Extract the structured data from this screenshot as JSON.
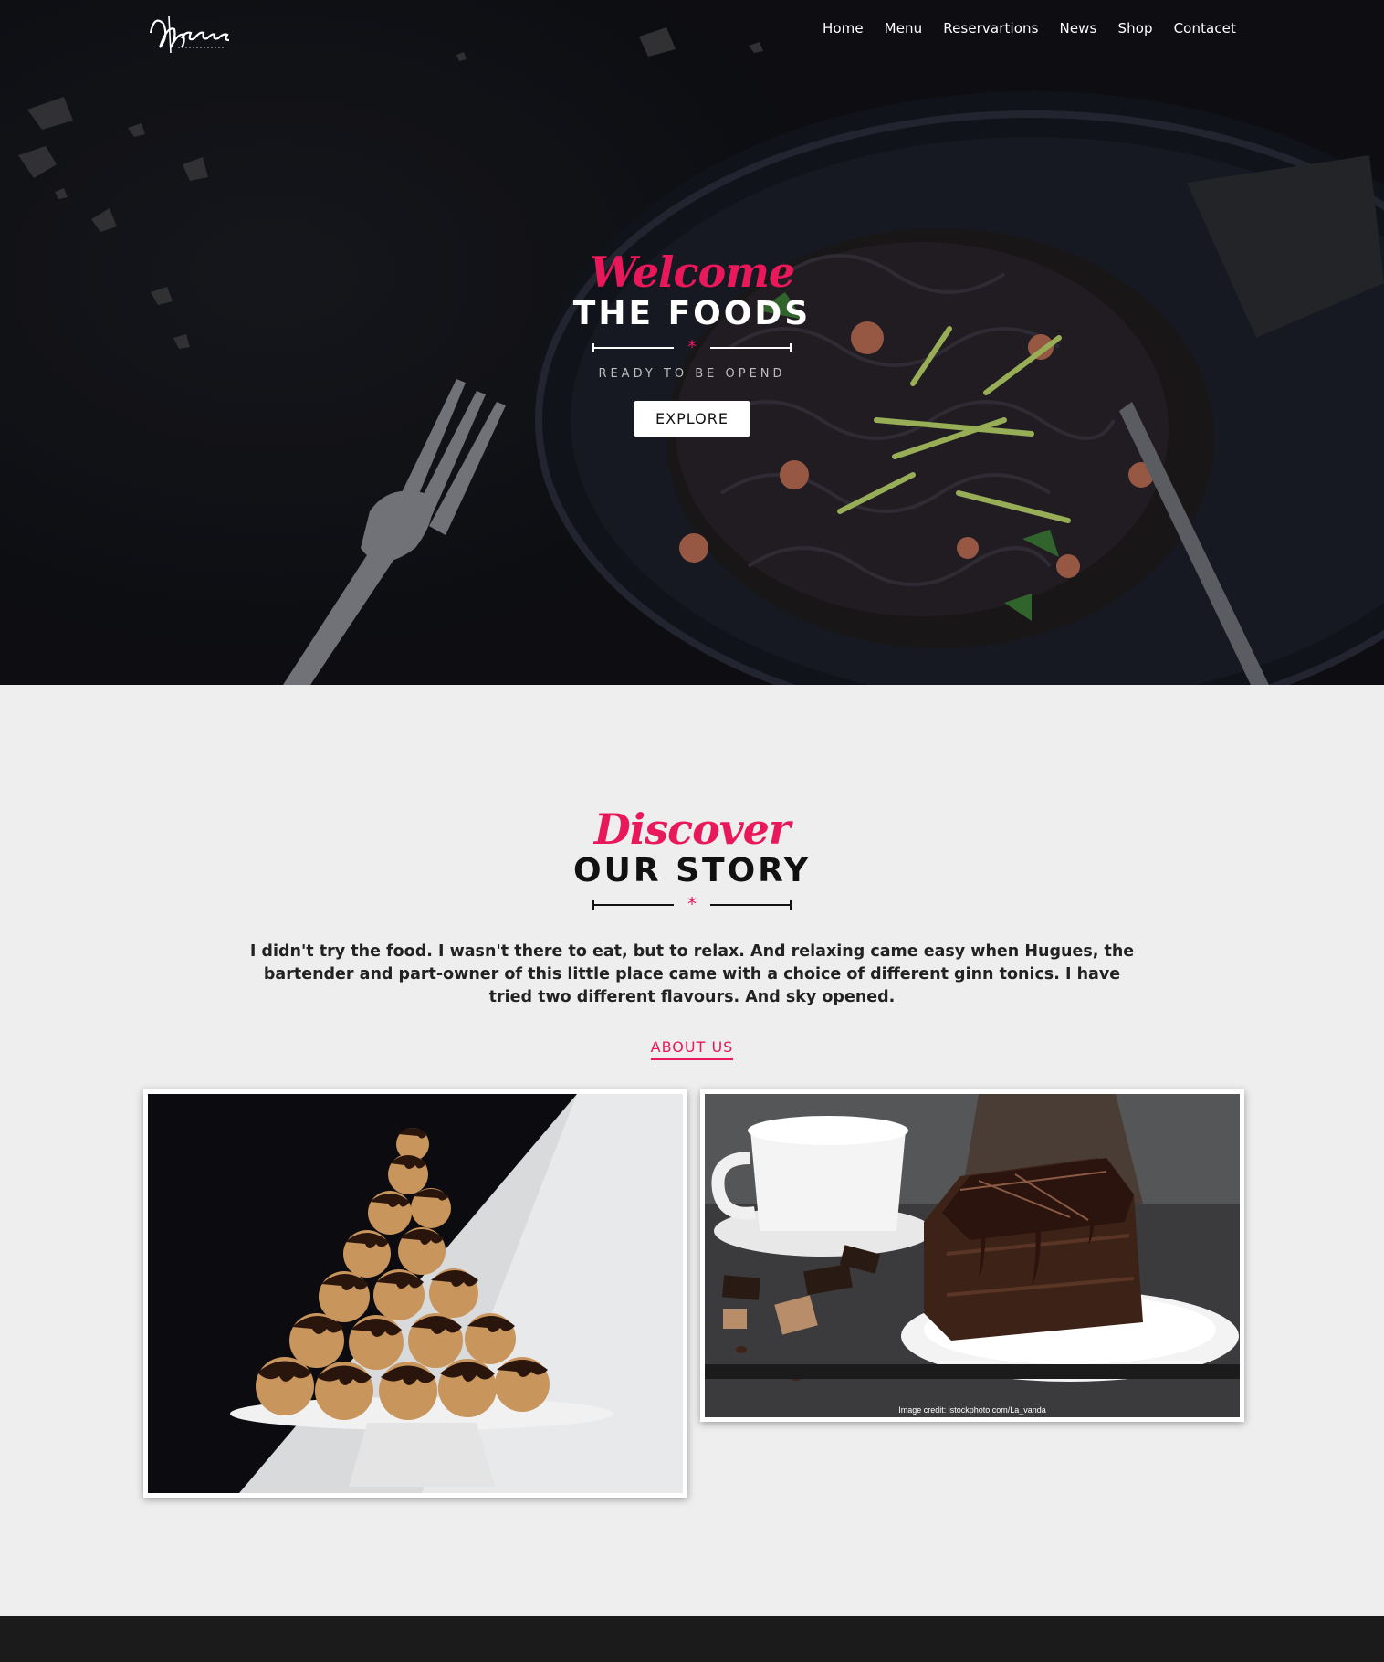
{
  "brand": {
    "logo_text": "Mohamed"
  },
  "nav": {
    "items": [
      "Home",
      "Menu",
      "Reservartions",
      "News",
      "Shop",
      "Contacet"
    ]
  },
  "hero": {
    "script": "Welcome",
    "title": "THE FOODS",
    "tagline": "READY TO BE OPEND",
    "button": "EXPLORE"
  },
  "story": {
    "script": "Discover",
    "title": "OUR STORY",
    "text": "I didn't try the food. I wasn't there to eat, but to relax. And relaxing came easy when Hugues, the bartender and part-owner of this little place came with a choice of different ginn tonics. I have tried two different flavours. And sky opened.",
    "link": "ABOUT US",
    "image_credit": "Image credit: istockphoto.com/La_vanda"
  },
  "colors": {
    "accent": "#e8185a",
    "hero_bg": "#0d0e12",
    "page_bg": "#eeeeee",
    "footer_bg": "#1b1b1b"
  }
}
